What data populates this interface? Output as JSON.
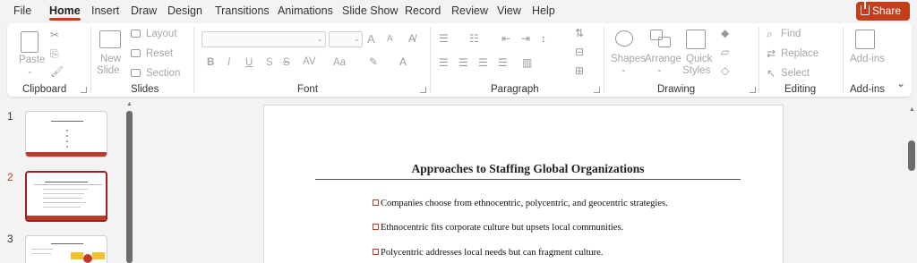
{
  "menu": {
    "tabs": [
      "File",
      "Home",
      "Insert",
      "Draw",
      "Design",
      "Transitions",
      "Animations",
      "Slide Show",
      "Record",
      "Review",
      "View",
      "Help"
    ],
    "active_tab": "Home",
    "share_label": "Share"
  },
  "ribbon": {
    "clipboard": {
      "label": "Clipboard",
      "paste": "Paste"
    },
    "slides": {
      "label": "Slides",
      "new_slide_1": "New",
      "new_slide_2": "Slide",
      "layout": "Layout",
      "reset": "Reset",
      "section": "Section"
    },
    "font": {
      "label": "Font",
      "bold": "B",
      "italic": "I",
      "underline": "U",
      "strike": "S",
      "spacing": "AV",
      "case": "Aa",
      "grow": "A",
      "shrink": "A"
    },
    "paragraph": {
      "label": "Paragraph"
    },
    "drawing": {
      "label": "Drawing",
      "shapes": "Shapes",
      "arrange": "Arrange",
      "quick_styles_1": "Quick",
      "quick_styles_2": "Styles"
    },
    "editing": {
      "label": "Editing",
      "find": "Find",
      "replace": "Replace",
      "select": "Select"
    },
    "addins": {
      "label": "Add-ins",
      "button": "Add-ins"
    }
  },
  "thumbnails": {
    "numbers": [
      "1",
      "2",
      "3"
    ],
    "selected": 2
  },
  "slide": {
    "title": "Approaches to Staffing Global Organizations",
    "bullets": [
      "Companies choose from ethnocentric, polycentric, and geocentric strategies.",
      "Ethnocentric fits corporate culture but upsets local communities.",
      "Polycentric addresses local needs but can fragment culture."
    ]
  },
  "colors": {
    "accent": "#c43e1c",
    "selected_thumb_border": "#9e1f1f",
    "bullet_box": "#c0392b"
  }
}
